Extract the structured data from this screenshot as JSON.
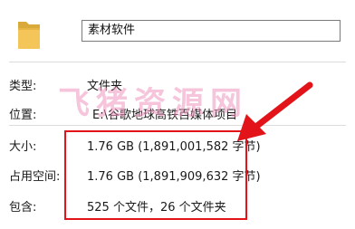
{
  "header": {
    "folder_icon": "folder-icon",
    "name_value": "素材软件"
  },
  "properties": {
    "type_label": "类型:",
    "type_value": "文件夹",
    "location_label": "位置:",
    "location_value": "E:\\谷歌地球高铁百媒体项目",
    "size_label": "大小:",
    "size_value": "1.76 GB (1,891,001,582 字节)",
    "disk_label": "占用空间:",
    "disk_value": "1.76 GB (1,891,909,632 字节)",
    "contains_label": "包含:",
    "contains_value": "525 个文件，26 个文件夹"
  },
  "overlay": {
    "watermark": "飞猪资源网",
    "highlight_color": "#e2141a"
  }
}
